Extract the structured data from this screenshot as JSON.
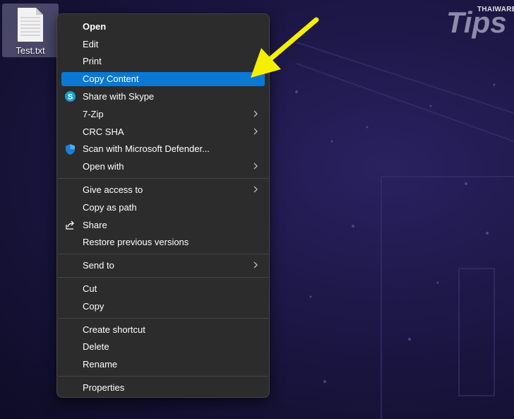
{
  "desktop": {
    "file_name": "Test.txt"
  },
  "watermark": {
    "brand": "THAIWARE",
    "name": "Tips"
  },
  "menu": {
    "groups": [
      [
        {
          "label": "Open",
          "bold": true
        },
        {
          "label": "Edit"
        },
        {
          "label": "Print"
        },
        {
          "label": "Copy Content",
          "highlighted": true
        },
        {
          "label": "Share with Skype",
          "icon": "skype-icon"
        },
        {
          "label": "7-Zip",
          "submenu": true
        },
        {
          "label": "CRC SHA",
          "submenu": true
        },
        {
          "label": "Scan with Microsoft Defender...",
          "icon": "defender-shield-icon"
        },
        {
          "label": "Open with",
          "submenu": true
        }
      ],
      [
        {
          "label": "Give access to",
          "submenu": true
        },
        {
          "label": "Copy as path"
        },
        {
          "label": "Share",
          "icon": "share-icon"
        },
        {
          "label": "Restore previous versions"
        }
      ],
      [
        {
          "label": "Send to",
          "submenu": true
        }
      ],
      [
        {
          "label": "Cut"
        },
        {
          "label": "Copy"
        }
      ],
      [
        {
          "label": "Create shortcut"
        },
        {
          "label": "Delete"
        },
        {
          "label": "Rename"
        }
      ],
      [
        {
          "label": "Properties"
        }
      ]
    ]
  },
  "colors": {
    "highlight": "#0a78d4",
    "menu_bg": "#2c2c2c",
    "arrow": "#f5f000"
  }
}
